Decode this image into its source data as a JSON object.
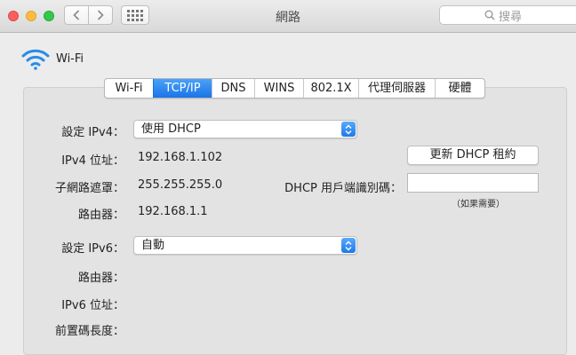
{
  "window": {
    "title": "網路"
  },
  "search": {
    "placeholder": "搜尋"
  },
  "service": {
    "name": "Wi-Fi"
  },
  "tabs": [
    "Wi-Fi",
    "TCP/IP",
    "DNS",
    "WINS",
    "802.1X",
    "代理伺服器",
    "硬體"
  ],
  "active_tab": "TCP/IP",
  "ipv4": {
    "config_label": "設定 IPv4：",
    "config_value": "使用 DHCP",
    "address_label": "IPv4 位址：",
    "address_value": "192.168.1.102",
    "subnet_label": "子網路遮罩：",
    "subnet_value": "255.255.255.0",
    "router_label": "路由器：",
    "router_value": "192.168.1.1"
  },
  "dhcp": {
    "renew_button": "更新 DHCP 租約",
    "client_id_label": "DHCP 用戶端識別碼：",
    "client_id_value": "",
    "client_id_hint": "（如果需要）"
  },
  "ipv6": {
    "config_label": "設定 IPv6：",
    "config_value": "自動",
    "router_label": "路由器：",
    "address_label": "IPv6 位址：",
    "prefix_label": "前置碼長度："
  },
  "colors": {
    "accent": "#1a74e8",
    "wifi_icon": "#2a8ce6"
  }
}
